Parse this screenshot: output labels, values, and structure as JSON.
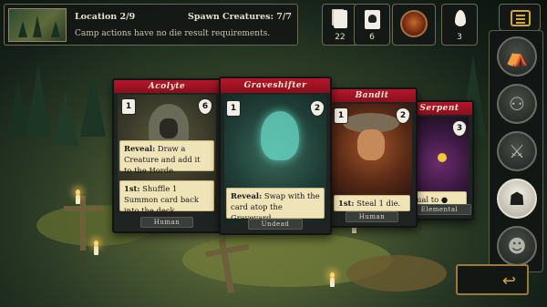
{
  "info": {
    "location": "Location 2/9",
    "spawn": "Spawn Creatures: 7/7",
    "note": "Camp actions have no die result requirements."
  },
  "counters": {
    "deck": "22",
    "horde": "6",
    "fire": "3"
  },
  "cards": {
    "acolyte": {
      "title": "Acolyte",
      "cost": "1",
      "health": "6",
      "ability1_key": "Reveal:",
      "ability1_text": " Draw a Creature and add it to the Horde.",
      "ability2_key": "1st:",
      "ability2_text": " Shuffle 1 Summon card back into the deck.",
      "type": "Human"
    },
    "graveshifter": {
      "title": "Graveshifter",
      "cost": "1",
      "health": "2",
      "ability1_key": "Reveal:",
      "ability1_text": " Swap with the card atop the Graveyard.",
      "type": "Undead"
    },
    "bandit": {
      "title": "Bandit",
      "cost": "1",
      "health": "2",
      "ability1_key": "1st:",
      "ability1_text": " Steal 1 die.",
      "type": "Human"
    },
    "serpent": {
      "title": "Serpent",
      "health": "3",
      "ability1_text": "ual to",
      "type": "Elemental"
    }
  },
  "colors": {
    "card_title": "#b3182a",
    "text_box": "#efe3b8",
    "accent_gold": "#d4a640"
  },
  "icons": {
    "menu": "menu-icon",
    "side": [
      "tent-icon",
      "three-circles-icon",
      "crossed-swords-icon",
      "ghost-icon",
      "group-icon"
    ],
    "back": "undo-arrow-icon"
  }
}
